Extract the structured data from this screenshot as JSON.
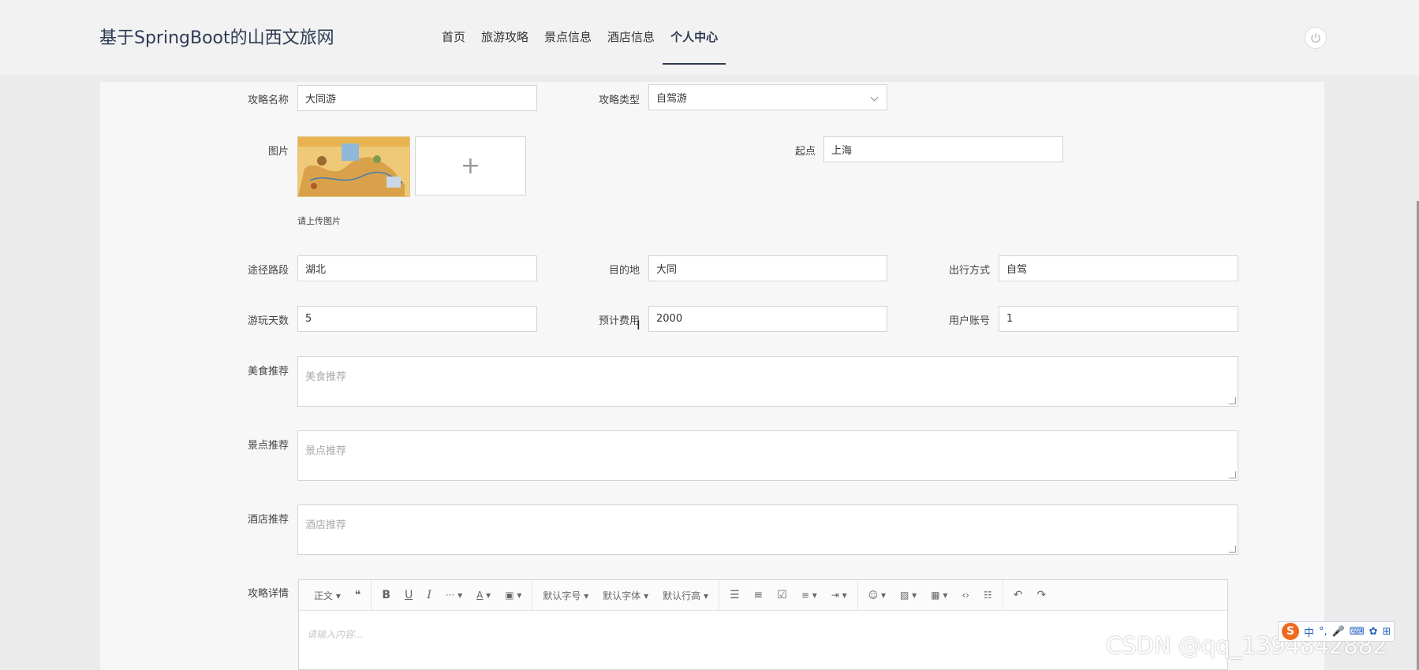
{
  "header": {
    "site_title": "基于SpringBoot的山西文旅网",
    "nav": [
      {
        "label": "首页"
      },
      {
        "label": "旅游攻略"
      },
      {
        "label": "景点信息"
      },
      {
        "label": "酒店信息"
      },
      {
        "label": "个人中心",
        "active": true
      }
    ],
    "power_icon": "power-icon"
  },
  "form": {
    "name": {
      "label": "攻略名称",
      "value": "大同游"
    },
    "type": {
      "label": "攻略类型",
      "value": "自驾游"
    },
    "image": {
      "label": "图片",
      "hint": "请上传图片",
      "add": "+"
    },
    "start": {
      "label": "起点",
      "value": "上海"
    },
    "route": {
      "label": "途径路段",
      "value": "湖北"
    },
    "destination": {
      "label": "目的地",
      "value": "大同"
    },
    "travel_mode": {
      "label": "出行方式",
      "value": "自驾"
    },
    "days": {
      "label": "游玩天数",
      "value": "5"
    },
    "cost": {
      "label": "预计费用",
      "value": "2000"
    },
    "account": {
      "label": "用户账号",
      "value": "1"
    },
    "food": {
      "label": "美食推荐",
      "placeholder": "美食推荐"
    },
    "spots": {
      "label": "景点推荐",
      "placeholder": "景点推荐"
    },
    "hotel": {
      "label": "酒店推荐",
      "placeholder": "酒店推荐"
    },
    "detail": {
      "label": "攻略详情",
      "placeholder": "请输入内容..."
    }
  },
  "editor_toolbar": {
    "paragraph": "正文",
    "font_size": "默认字号",
    "font_family": "默认字体",
    "line_height": "默认行高"
  },
  "overlay": {
    "watermark": "CSDN @qq_1394842882",
    "ime_label": "中"
  },
  "colors": {
    "accent": "#2d3b52",
    "ime": "#f06a1e"
  }
}
